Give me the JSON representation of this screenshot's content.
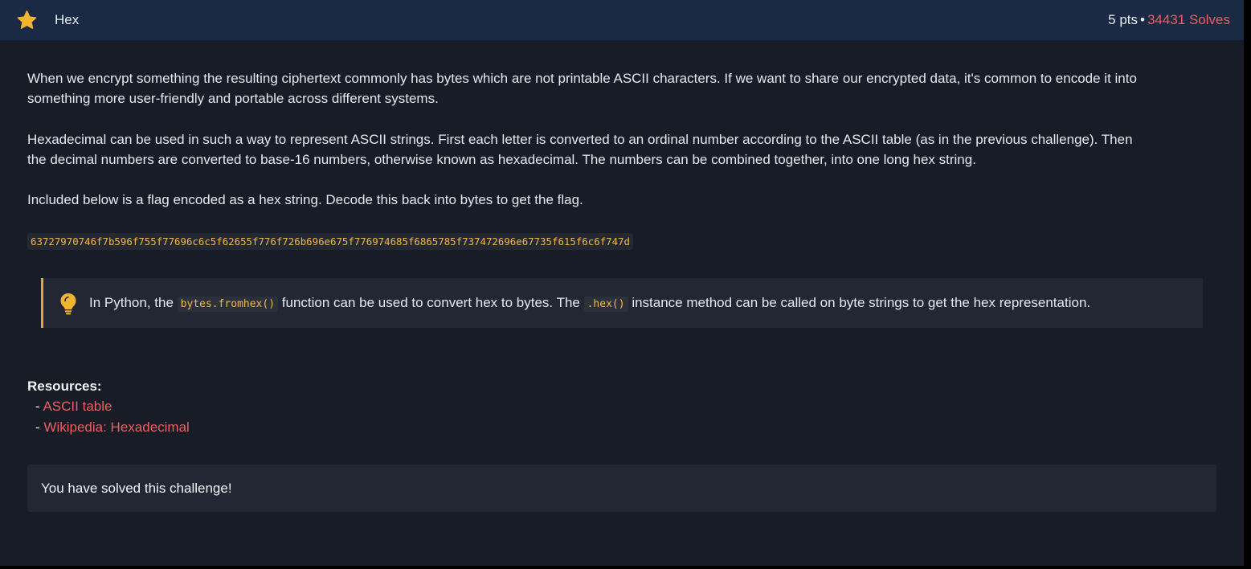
{
  "header": {
    "icon": "star-icon",
    "title": "Hex",
    "points": "5 pts",
    "separator": "•",
    "solves": "34431 Solves"
  },
  "description": {
    "paragraph1_line1": "When we encrypt something the resulting ciphertext commonly has bytes which are not printable ASCII characters. If we want to share our encrypted data, it's common to encode it into",
    "paragraph1_line2": "something more user-friendly and portable across different systems.",
    "paragraph2_line1": "Hexadecimal can be used in such a way to represent ASCII strings. First each letter is converted to an ordinal number according to the ASCII table (as in the previous challenge). Then",
    "paragraph2_line2": "the decimal numbers are converted to base-16 numbers, otherwise known as hexadecimal. The numbers can be combined together, into one long hex string.",
    "paragraph3": "Included below is a flag encoded as a hex string. Decode this back into bytes to get the flag."
  },
  "hex_string": "63727970746f7b596f755f77696c6c5f62655f776f726b696e675f776974685f6865785f737472696e67735f615f6c6f747d",
  "hint": {
    "icon": "lightbulb-icon",
    "text_before": "In Python, the",
    "code1": "bytes.fromhex()",
    "text_middle": "function can be used to convert hex to bytes. The",
    "code2": ".hex()",
    "text_after": "instance method can be called on byte strings to get the hex representation."
  },
  "resources": {
    "label": "Resources:",
    "dash": "-",
    "links": [
      {
        "label": "ASCII table"
      },
      {
        "label": "Wikipedia: Hexadecimal"
      }
    ]
  },
  "status": {
    "message": "You have solved this challenge!"
  },
  "colors": {
    "header_bg": "#1a2a45",
    "panel_bg": "#171c27",
    "accent_red": "#ec5f5f",
    "accent_gold": "#f0b84a",
    "hint_border": "#e3a73a"
  }
}
